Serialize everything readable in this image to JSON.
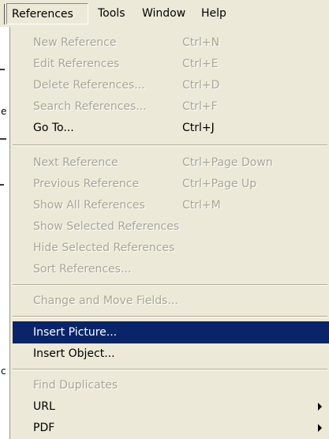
{
  "menubar": {
    "items": [
      {
        "label": "References",
        "active": true
      },
      {
        "label": "Tools",
        "active": false
      },
      {
        "label": "Window",
        "active": false
      },
      {
        "label": "Help",
        "active": false
      }
    ]
  },
  "background": {
    "chars": [
      "t",
      "e",
      "t",
      "c"
    ]
  },
  "dropdown": {
    "items": [
      {
        "label": "New Reference",
        "shortcut": "Ctrl+N",
        "enabled": false
      },
      {
        "label": "Edit References",
        "shortcut": "Ctrl+E",
        "enabled": false
      },
      {
        "label": "Delete References...",
        "shortcut": "Ctrl+D",
        "enabled": false
      },
      {
        "label": "Search References...",
        "shortcut": "Ctrl+F",
        "enabled": false
      },
      {
        "label": "Go To...",
        "shortcut": "Ctrl+J",
        "enabled": true
      },
      {
        "label": "Next Reference",
        "shortcut": "Ctrl+Page Down",
        "enabled": false
      },
      {
        "label": "Previous Reference",
        "shortcut": "Ctrl+Page Up",
        "enabled": false
      },
      {
        "label": "Show All References",
        "shortcut": "Ctrl+M",
        "enabled": false
      },
      {
        "label": "Show Selected References",
        "shortcut": "",
        "enabled": false
      },
      {
        "label": "Hide Selected References",
        "shortcut": "",
        "enabled": false
      },
      {
        "label": "Sort References...",
        "shortcut": "",
        "enabled": false
      },
      {
        "label": "Change and Move Fields...",
        "shortcut": "",
        "enabled": false
      },
      {
        "label": "Insert Picture...",
        "shortcut": "",
        "enabled": true,
        "highlighted": true
      },
      {
        "label": "Insert Object...",
        "shortcut": "",
        "enabled": true
      },
      {
        "label": "Find Duplicates",
        "shortcut": "",
        "enabled": false
      },
      {
        "label": "URL",
        "shortcut": "",
        "enabled": true,
        "submenu": true
      },
      {
        "label": "PDF",
        "shortcut": "",
        "enabled": true,
        "submenu": true
      }
    ]
  },
  "colors": {
    "menu_bg": "#ece9d8",
    "highlight_bg": "#0a246a",
    "disabled_text": "#a8a598"
  }
}
